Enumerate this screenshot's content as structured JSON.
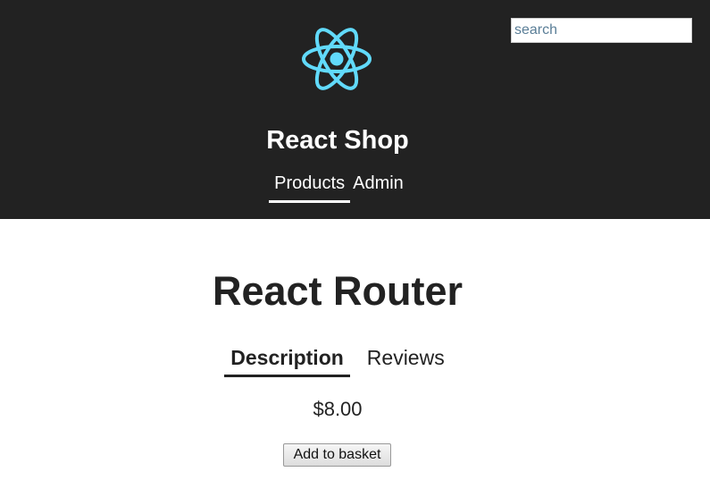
{
  "header": {
    "logo_icon": "react-atom-icon",
    "logo_color": "#61dafb",
    "title": "React Shop",
    "background": "#222222"
  },
  "search": {
    "placeholder": "search",
    "value": ""
  },
  "nav": {
    "items": [
      {
        "label": "Products",
        "active": true
      },
      {
        "label": "Admin",
        "active": false
      }
    ]
  },
  "product": {
    "title": "React Router",
    "tabs": [
      {
        "label": "Description",
        "active": true
      },
      {
        "label": "Reviews",
        "active": false
      }
    ],
    "price": "$8.00",
    "add_button_label": "Add to basket"
  }
}
